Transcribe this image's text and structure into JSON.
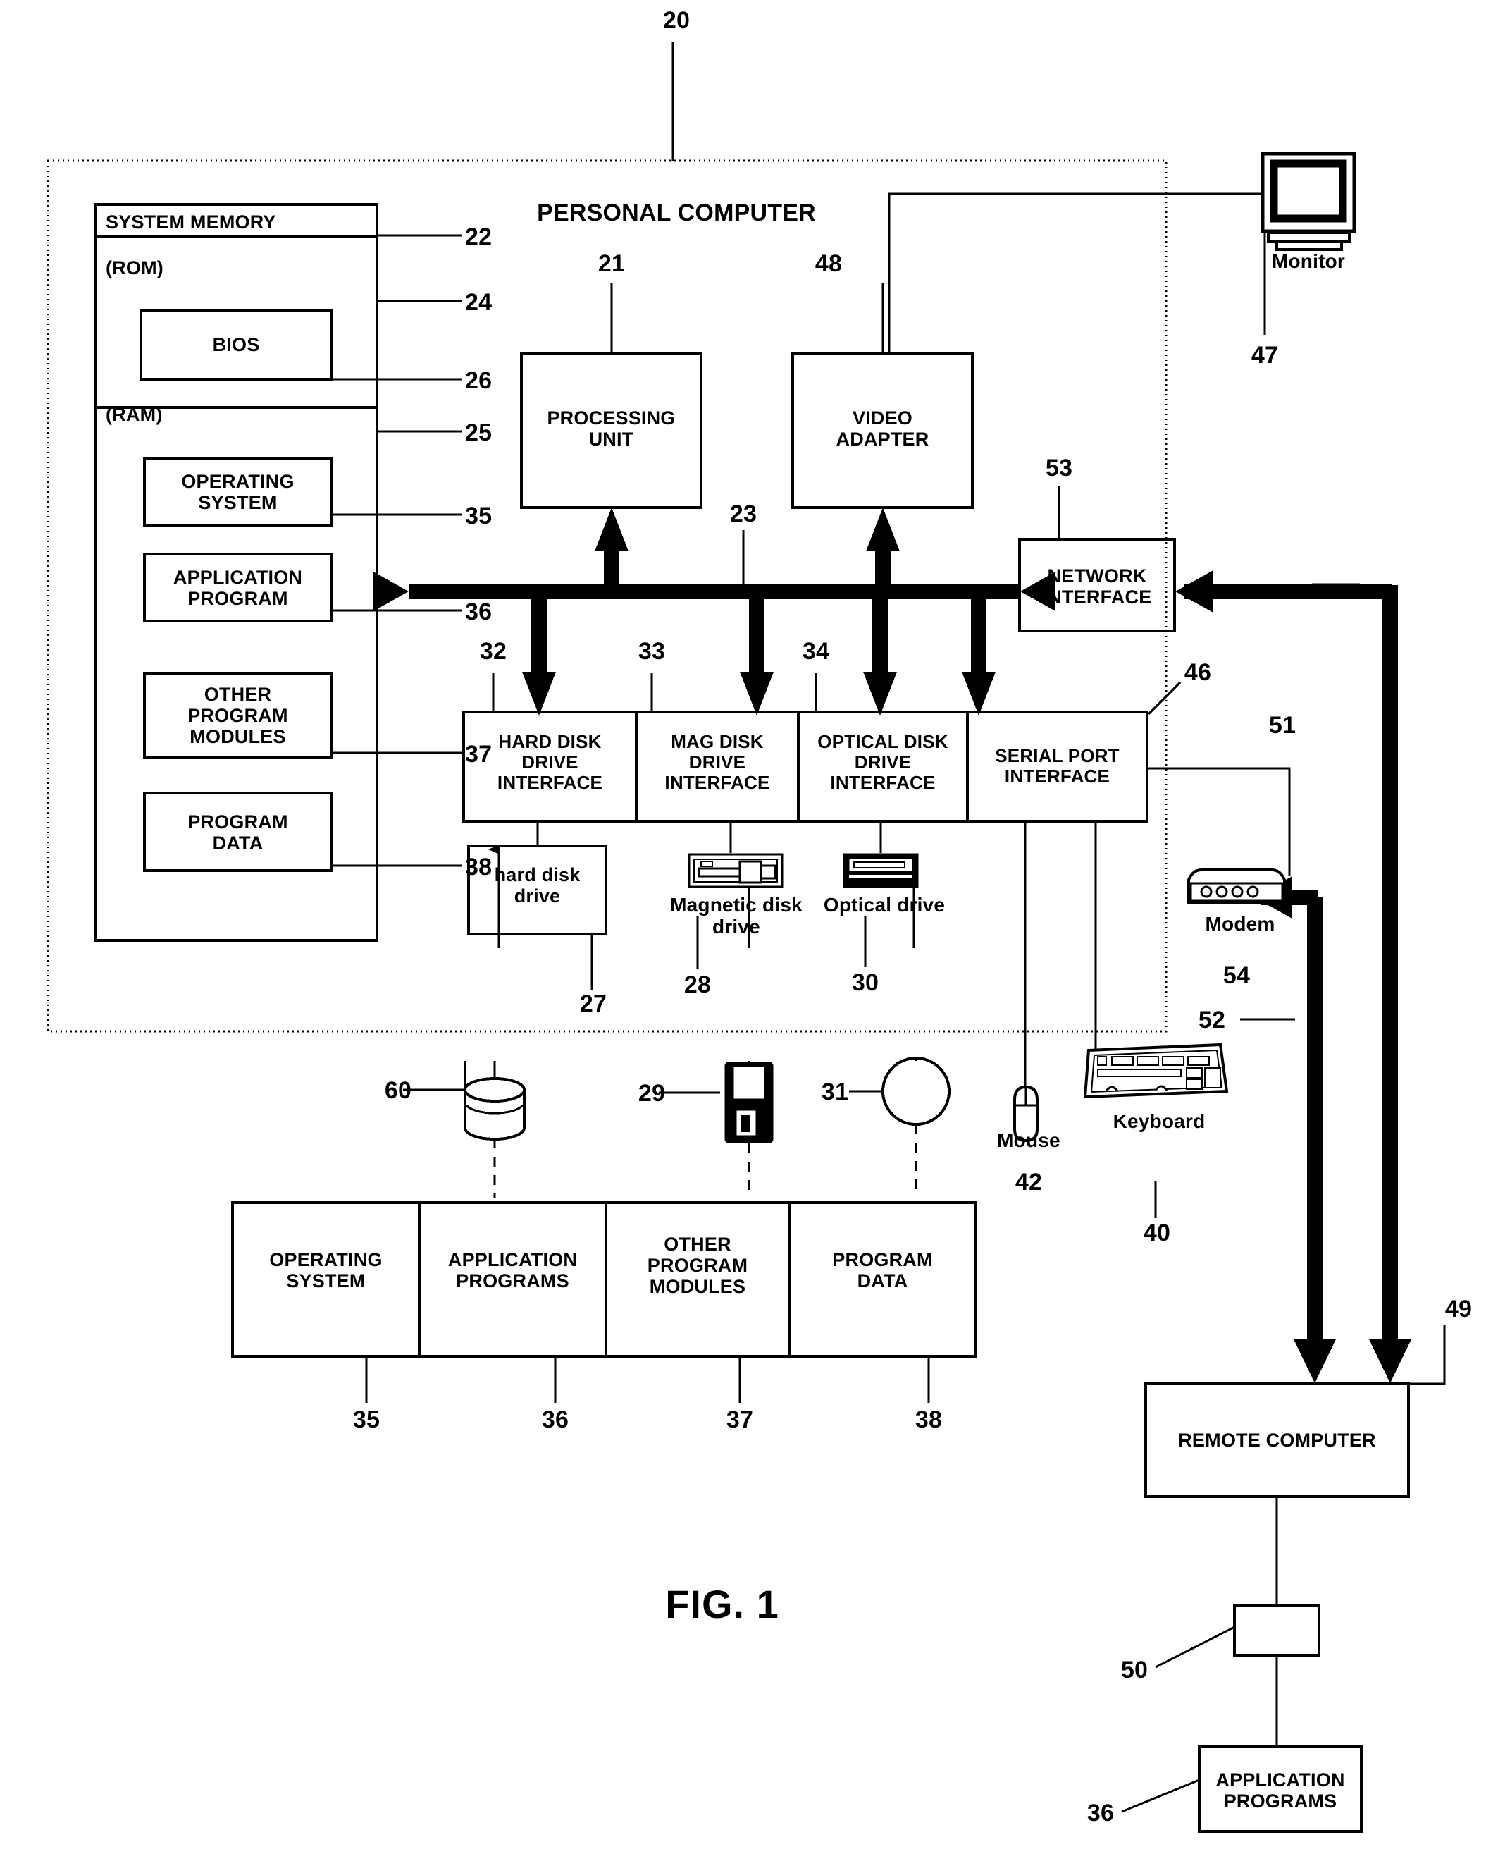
{
  "figure": {
    "label": "FIG. 1",
    "top_reference": "20",
    "system_title": "PERSONAL COMPUTER"
  },
  "memory": {
    "title": "SYSTEM MEMORY",
    "title_ref": "22",
    "rom_label": "(ROM)",
    "rom_ref": "24",
    "bios_label": "BIOS",
    "bios_ref": "26",
    "ram_label": "(RAM)",
    "ram_ref": "25",
    "items": [
      {
        "label": "OPERATING\nSYSTEM",
        "ref": "35"
      },
      {
        "label": "APPLICATION\nPROGRAM",
        "ref": "36"
      },
      {
        "label": "OTHER\nPROGRAM\nMODULES",
        "ref": "37"
      },
      {
        "label": "PROGRAM\nDATA",
        "ref": "38"
      }
    ]
  },
  "core": {
    "processing_unit": {
      "label": "PROCESSING\nUNIT",
      "ref": "21"
    },
    "video_adapter": {
      "label": "VIDEO\nADAPTER",
      "ref": "48"
    },
    "system_bus_ref": "23",
    "network_interface": {
      "label": "NETWORK\nINTERFACE",
      "ref": "53"
    }
  },
  "interfaces": [
    {
      "label": "HARD DISK\nDRIVE\nINTERFACE",
      "ref": "32"
    },
    {
      "label": "MAG DISK\nDRIVE\nINTERFACE",
      "ref": "33"
    },
    {
      "label": "OPTICAL DISK\nDRIVE\nINTERFACE",
      "ref": "34"
    },
    {
      "label": "SERIAL PORT\nINTERFACE",
      "ref": "46"
    }
  ],
  "drives": [
    {
      "label": "hard disk\ndrive",
      "ref": "27"
    },
    {
      "label": "Magnetic disk\ndrive",
      "ref": "28"
    },
    {
      "label": "Optical drive",
      "ref": "30"
    }
  ],
  "media": [
    {
      "name": "hard-disk-platter",
      "ref": "60"
    },
    {
      "name": "floppy-diskette",
      "ref": "29"
    },
    {
      "name": "optical-disc",
      "ref": "31"
    }
  ],
  "peripherals": {
    "monitor": {
      "label": "Monitor",
      "ref": "47"
    },
    "mouse": {
      "label": "Mouse",
      "ref": "42"
    },
    "keyboard": {
      "label": "Keyboard",
      "ref": "40"
    },
    "modem": {
      "label": "Modem",
      "ref": "54"
    }
  },
  "storage_contents": [
    {
      "label": "OPERATING\nSYSTEM",
      "ref": "35"
    },
    {
      "label": "APPLICATION\nPROGRAMS",
      "ref": "36"
    },
    {
      "label": "OTHER\nPROGRAM\nMODULES",
      "ref": "37"
    },
    {
      "label": "PROGRAM\nDATA",
      "ref": "38"
    }
  ],
  "network": {
    "lan_ref": "51",
    "wan_ref": "52",
    "remote_computer": {
      "label": "REMOTE COMPUTER",
      "ref": "49"
    },
    "memory_store_ref": "50",
    "remote_apps": {
      "label": "APPLICATION\nPROGRAMS",
      "ref": "36"
    }
  },
  "colors": {
    "ink": "#000000",
    "paper": "#ffffff"
  }
}
